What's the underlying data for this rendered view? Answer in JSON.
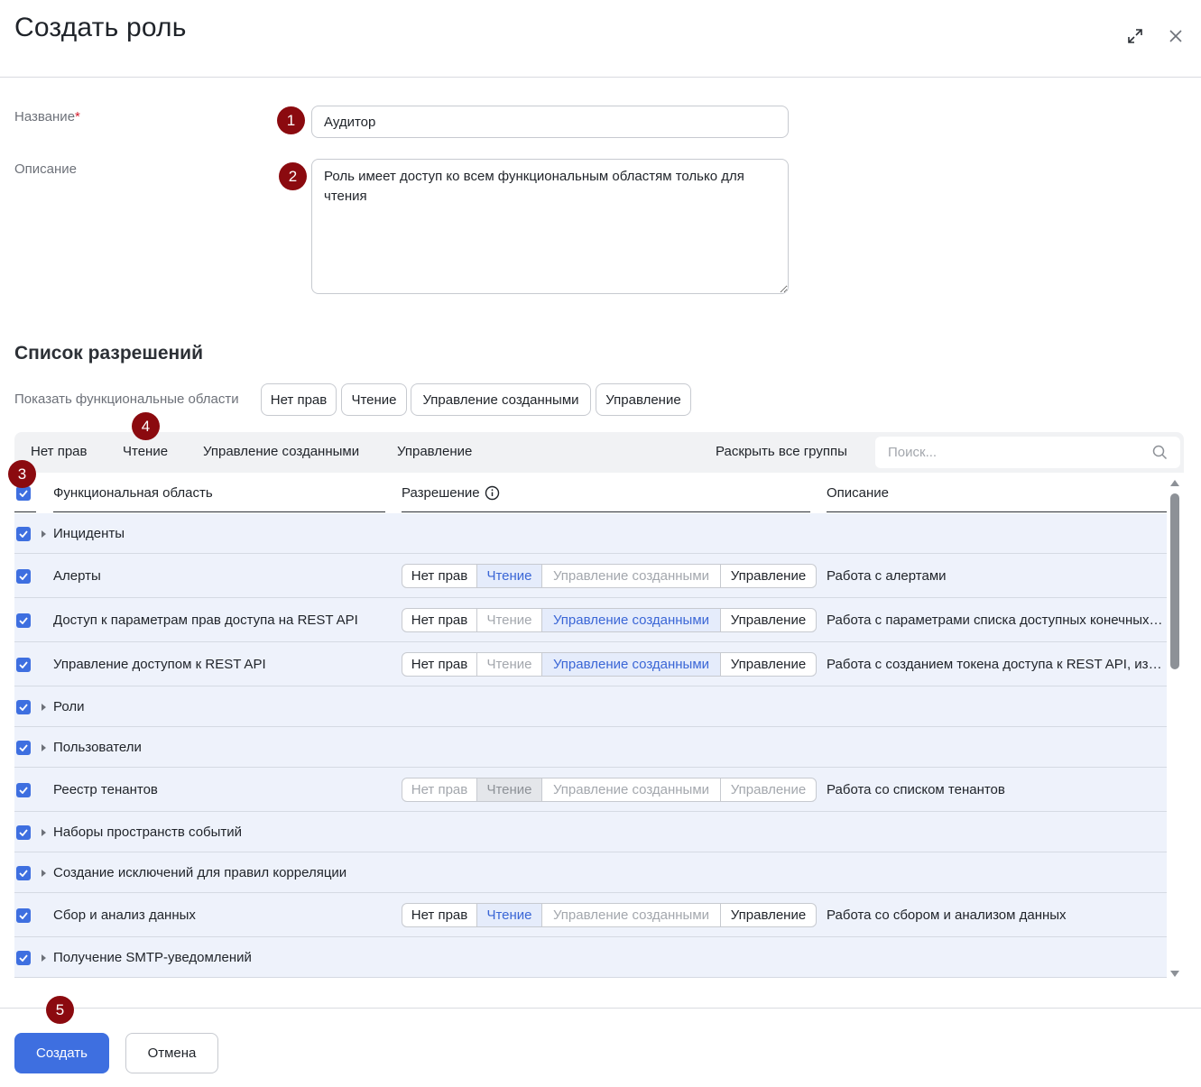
{
  "dialog": {
    "title": "Создать роль",
    "expand_icon": "expand-icon",
    "close_icon": "close-icon"
  },
  "form": {
    "name_label": "Название",
    "name_required_mark": "*",
    "name_value": "Аудитор",
    "description_label": "Описание",
    "description_value": "Роль имеет доступ ко всем функциональным областям только для чтения"
  },
  "markers": [
    "1",
    "2",
    "3",
    "4",
    "5"
  ],
  "permissions": {
    "title": "Список разрешений",
    "filter_label": "Показать функциональные области",
    "filter_chips": [
      "Нет прав",
      "Чтение",
      "Управление созданными",
      "Управление"
    ],
    "toolbar": {
      "bulk_actions": [
        "Нет прав",
        "Чтение",
        "Управление созданными",
        "Управление"
      ],
      "expand_all": "Раскрыть все группы",
      "search_placeholder": "Поиск..."
    },
    "columns": {
      "area": "Функциональная область",
      "permission": "Разрешение",
      "description": "Описание"
    },
    "levels": [
      "Нет прав",
      "Чтение",
      "Управление созданными",
      "Управление"
    ],
    "rows": [
      {
        "label": "Инциденты",
        "group": true,
        "checked": true
      },
      {
        "label": "Алерты",
        "group": false,
        "checked": true,
        "selected": "Чтение",
        "description": "Работа с алертами"
      },
      {
        "label": "Доступ к параметрам прав доступа на REST API",
        "group": false,
        "checked": true,
        "selected": "Управление созданными",
        "description": "Работа с параметрами списка доступных конечных точек"
      },
      {
        "label": "Управление доступом к REST API",
        "group": false,
        "checked": true,
        "selected": "Управление созданными",
        "description": "Работа с созданием токена доступа к REST API, изменением и удалением"
      },
      {
        "label": "Роли",
        "group": true,
        "checked": true
      },
      {
        "label": "Пользователи",
        "group": true,
        "checked": true
      },
      {
        "label": "Реестр тенантов",
        "group": false,
        "checked": true,
        "selected": "Чтение",
        "disabled": true,
        "description": "Работа со списком тенантов"
      },
      {
        "label": "Наборы пространств событий",
        "group": true,
        "checked": true
      },
      {
        "label": "Создание исключений для правил корреляции",
        "group": true,
        "checked": true
      },
      {
        "label": "Сбор и анализ данных",
        "group": false,
        "checked": true,
        "selected": "Чтение",
        "description": "Работа со сбором и анализом данных"
      },
      {
        "label": "Получение SMTP-уведомлений",
        "group": true,
        "checked": true
      }
    ]
  },
  "footer": {
    "create_label": "Создать",
    "cancel_label": "Отмена"
  },
  "colors": {
    "accent": "#3e6fe0",
    "marker": "#8b0a0f",
    "row_bg": "#eef2fb",
    "selected_bg": "#e5ecfb"
  }
}
